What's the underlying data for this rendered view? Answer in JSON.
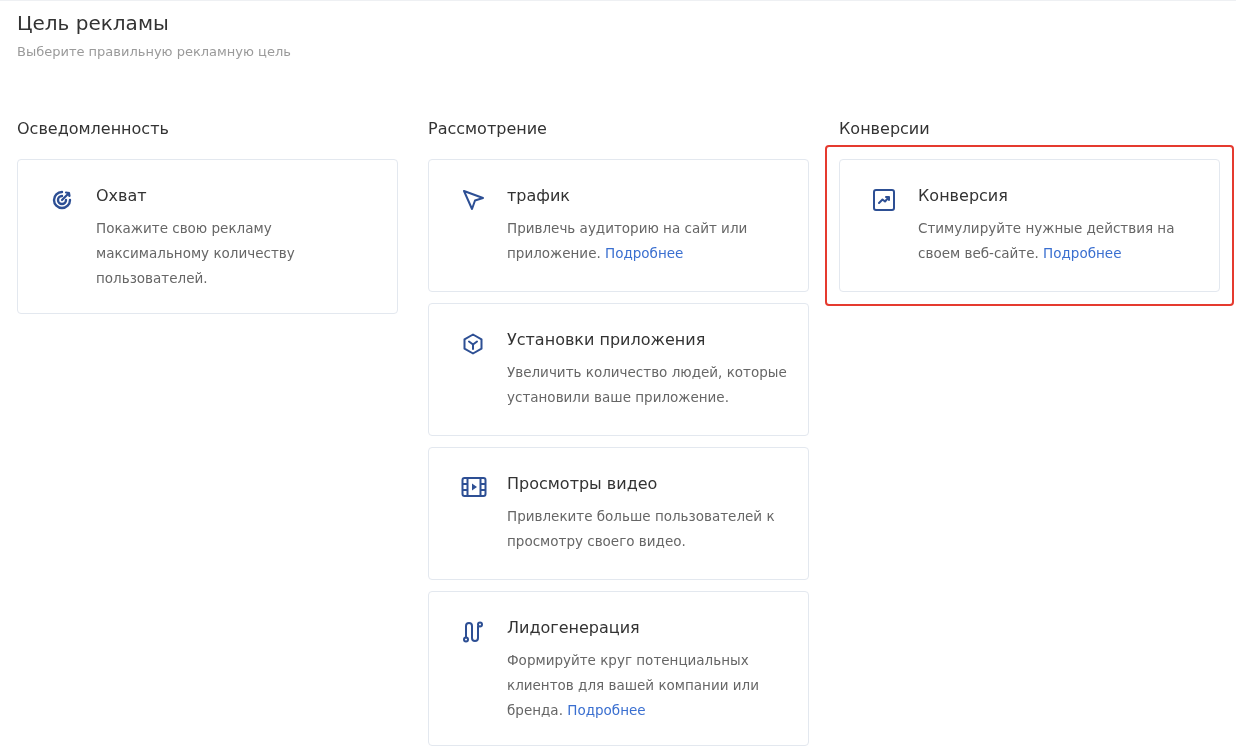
{
  "header": {
    "title": "Цель рекламы",
    "subtitle": "Выберите правильную рекламную цель"
  },
  "columns": [
    {
      "heading": "Осведомленность",
      "cards": [
        {
          "kind": "target",
          "title": "Охват",
          "description": "Покажите свою рекламу максимальному количеству пользователей.",
          "highlighted": false
        }
      ]
    },
    {
      "heading": "Рассмотрение",
      "cards": [
        {
          "kind": "cursor",
          "title": "трафик",
          "description": "Привлечь аудиторию на сайт или приложение.",
          "link": "Подробнее",
          "highlighted": false
        },
        {
          "kind": "cube",
          "title": "Установки приложения",
          "description": "Увеличить количество людей, которые установили ваше приложение.",
          "highlighted": false
        },
        {
          "kind": "video",
          "title": "Просмотры видео",
          "description": "Привлеките больше пользователей к просмотру своего видео.",
          "highlighted": false
        },
        {
          "kind": "route",
          "title": "Лидогенерация",
          "description": "Формируйте круг потенциальных клиентов для вашей компании или бренда.",
          "link": "Подробнее",
          "highlighted": false
        }
      ]
    },
    {
      "heading": "Конверсии",
      "cards": [
        {
          "kind": "chart",
          "title": "Конверсия",
          "description": "Стимулируйте нужные действия на своем веб-сайте.",
          "link": "Подробнее",
          "highlighted": true
        }
      ]
    }
  ]
}
